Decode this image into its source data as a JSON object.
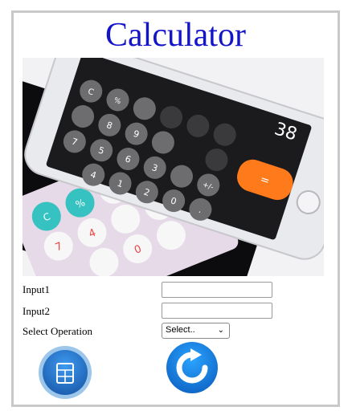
{
  "app": {
    "title": "Calculator"
  },
  "hero_image": {
    "display_number": "38",
    "keys": {
      "plus_minus": "+/-",
      "percent": "%",
      "clear": "C",
      "equals": "=",
      "dot": ".",
      "numbers": [
        "0",
        "1",
        "2",
        "3",
        "4",
        "5",
        "6",
        "7",
        "8",
        "9"
      ]
    },
    "colors": {
      "orange_key": "#ff7a1a",
      "teal_key": "#36c2c0",
      "phone_body": "#e9eaee",
      "screen_bg": "#1b1b1d"
    }
  },
  "form": {
    "input1_label": "Input1",
    "input1_value": "",
    "input2_label": "Input2",
    "input2_value": "",
    "operation_label": "Select Operation",
    "operation_selected": "Select..",
    "calculate_button_icon": "calculator-icon",
    "reset_button_icon": "refresh-icon"
  },
  "colors": {
    "title_blue": "#1414c8",
    "frame_border": "#c9c9c9",
    "calc_button_blue": "#1e74c8",
    "reset_button_blue": "#1b8ae8"
  }
}
